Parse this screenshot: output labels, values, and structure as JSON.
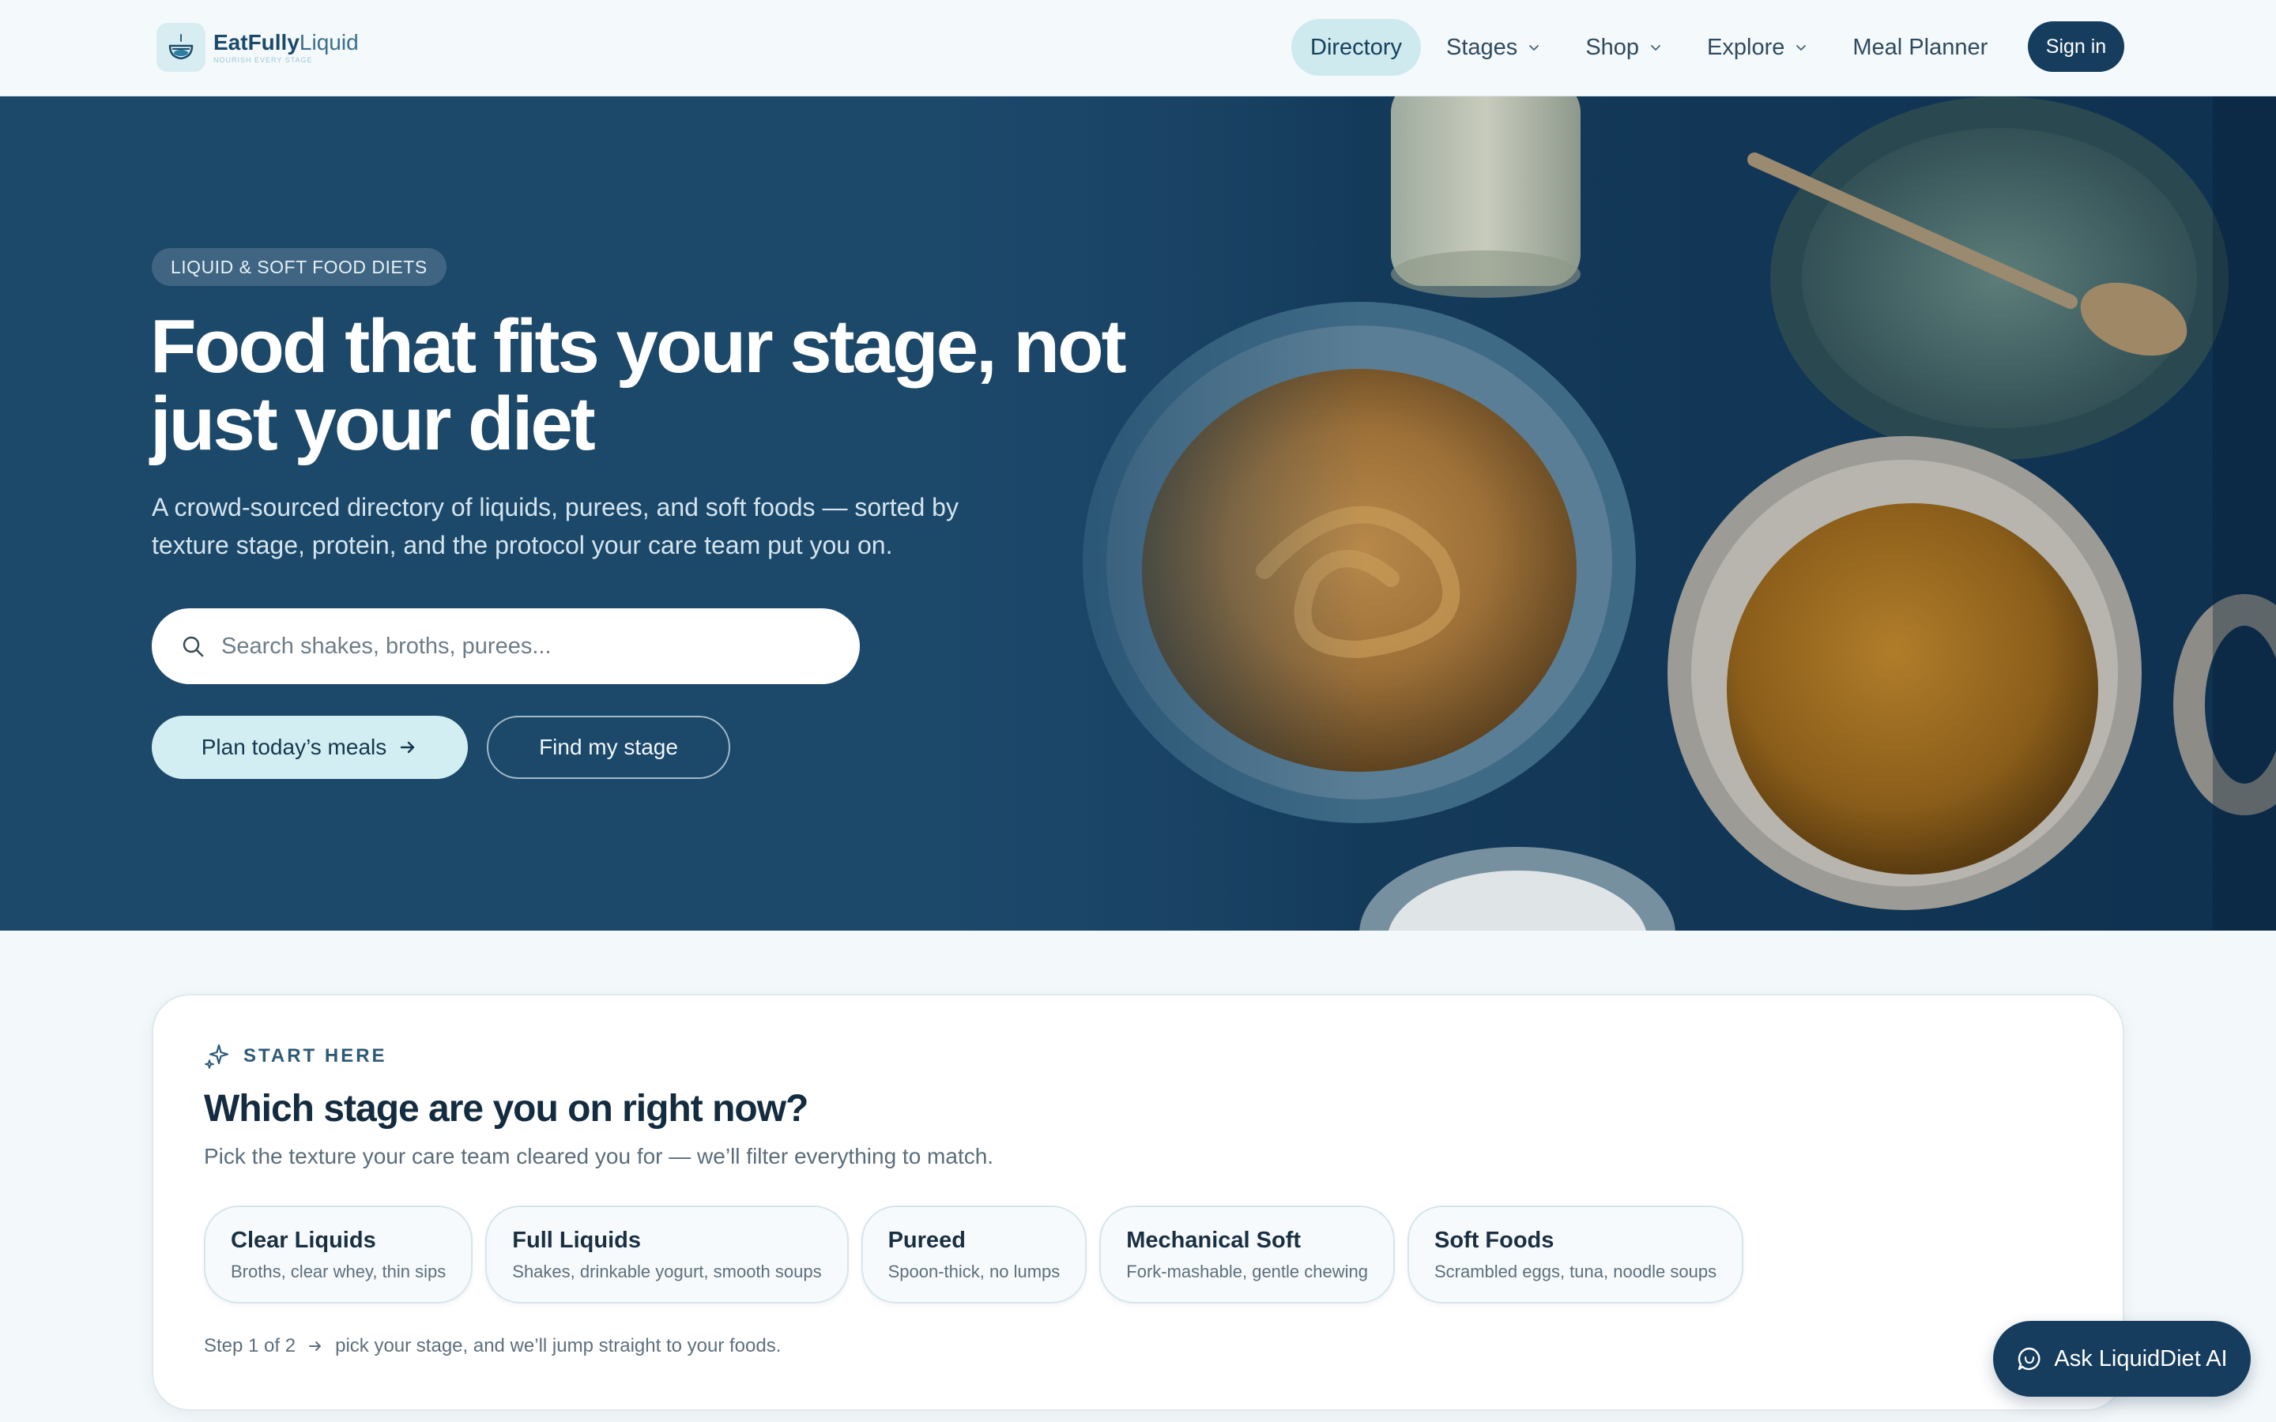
{
  "header": {
    "brand_bold": "EatFully",
    "brand_light": "Liquid",
    "brand_tag": "NOURISH EVERY STAGE",
    "nav": [
      {
        "label": "Directory",
        "has_menu": false,
        "active": true
      },
      {
        "label": "Stages",
        "has_menu": true,
        "active": false
      },
      {
        "label": "Shop",
        "has_menu": true,
        "active": false
      },
      {
        "label": "Explore",
        "has_menu": true,
        "active": false
      },
      {
        "label": "Meal Planner",
        "has_menu": false,
        "active": false
      }
    ],
    "signin_label": "Sign in"
  },
  "hero": {
    "eyebrow": "LIQUID & SOFT FOOD DIETS",
    "title": "Food that fits your stage, not just your diet",
    "subtitle": "A crowd-sourced directory of liquids, purees, and soft foods — sorted by texture stage, protein, and the protocol your care team put you on.",
    "search_placeholder": "Search shakes, broths, purees...",
    "primary_cta": "Plan today’s meals",
    "secondary_cta": "Find my stage"
  },
  "stage_picker": {
    "eyebrow": "START HERE",
    "title": "Which stage are you on right now?",
    "subtitle": "Pick the texture your care team cleared you for — we’ll filter everything to match.",
    "stages": [
      {
        "name": "Clear Liquids",
        "desc": "Broths, clear whey, thin sips"
      },
      {
        "name": "Full Liquids",
        "desc": "Shakes, drinkable yogurt, smooth soups"
      },
      {
        "name": "Pureed",
        "desc": "Spoon-thick, no lumps"
      },
      {
        "name": "Mechanical Soft",
        "desc": "Fork-mashable, gentle chewing"
      },
      {
        "name": "Soft Foods",
        "desc": "Scrambled eggs, tuna, noodle soups"
      }
    ],
    "step_label": "Step 1 of 2",
    "step_text": "pick your stage, and we’ll jump straight to your foods."
  },
  "assistant": {
    "label": "Ask LiquidDiet AI"
  },
  "colors": {
    "primary_navy": "#163d5e",
    "accent_mint": "#d3eef2",
    "page_bg": "#f3f8fa"
  }
}
